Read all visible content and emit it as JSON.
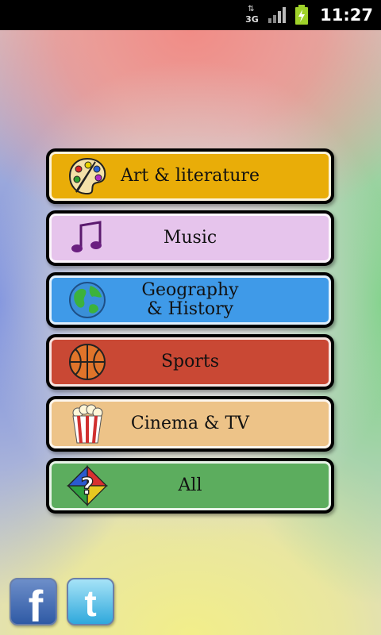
{
  "status_bar": {
    "network_label": "3G",
    "clock": "11:27",
    "icons": [
      "data-arrows-icon",
      "signal-bars-icon",
      "battery-charging-icon"
    ]
  },
  "categories": [
    {
      "label": "Art & literature",
      "icon": "paint-palette-icon",
      "color": "#e9ad08"
    },
    {
      "label": "Music",
      "icon": "music-note-icon",
      "color": "#e6c4ec"
    },
    {
      "label": "Geography\n& History",
      "icon": "globe-icon",
      "color": "#3f9ae8"
    },
    {
      "label": "Sports",
      "icon": "basketball-icon",
      "color": "#c94834"
    },
    {
      "label": "Cinema & TV",
      "icon": "popcorn-icon",
      "color": "#edc388"
    },
    {
      "label": "All",
      "icon": "question-diamond-icon",
      "color": "#5cad5e"
    }
  ],
  "social": {
    "facebook_glyph": "f",
    "twitter_glyph": "t",
    "facebook_color": "#3b5998",
    "twitter_color": "#2fa8dc"
  }
}
